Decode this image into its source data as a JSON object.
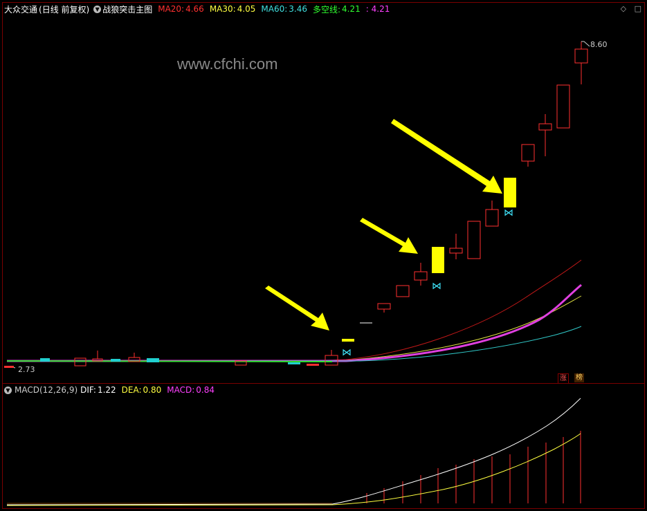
{
  "header": {
    "stock_name": "大众交通",
    "period": "(日线 前复权)",
    "indicator_name": "战狼突击主图",
    "ma20_label": "MA20:",
    "ma20_value": "4.66",
    "ma30_label": "MA30:",
    "ma30_value": "4.05",
    "ma60_label": "MA60:",
    "ma60_value": "3.46",
    "dk_label": "多空线:",
    "dk_value": "4.21",
    "extra_value": ": 4.21"
  },
  "watermark": "www.cfchi.com",
  "price_labels": {
    "high": "8.60",
    "low": "2.73"
  },
  "badges": {
    "zhang": "涨",
    "bang": "榜"
  },
  "macd": {
    "title": "MACD(12,26,9)",
    "dif_label": "DIF:",
    "dif_value": "1.22",
    "dea_label": "DEA:",
    "dea_value": "0.80",
    "macd_label": "MACD:",
    "macd_value": "0.84"
  },
  "colors": {
    "up": "#ff3030",
    "down": "#00d8d8",
    "ma20": "#ff2a2a",
    "ma30": "#ffff40",
    "ma60": "#40e0e0",
    "dk": "#ff40ff",
    "dif": "#ffffff",
    "dea": "#ffff40",
    "signal": "#ffff00",
    "butterfly": "#40e8ff"
  },
  "icons": [
    "chevron-down-icon",
    "diamond-icon",
    "square-icon",
    "arrow-icon",
    "butterfly-icon"
  ]
}
